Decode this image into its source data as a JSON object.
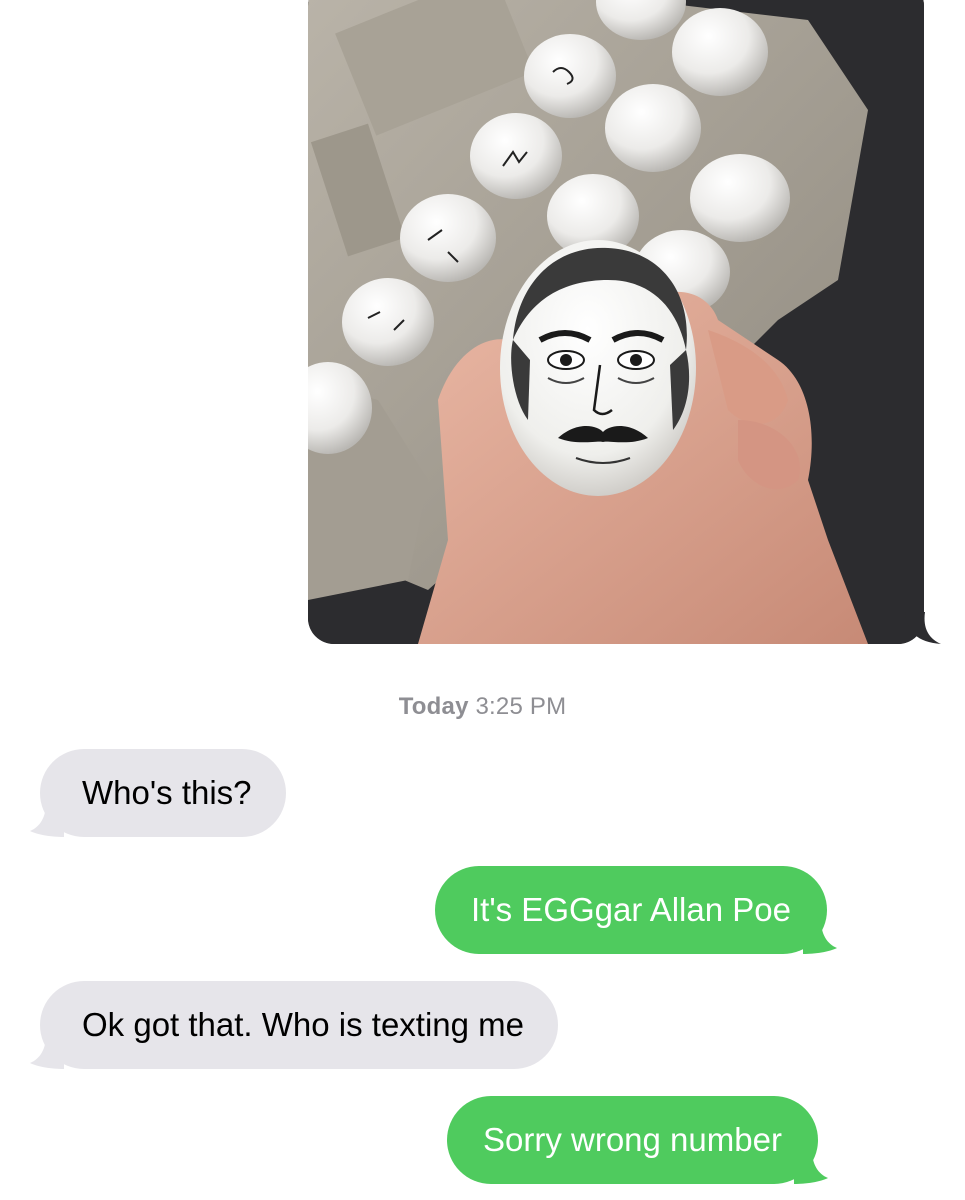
{
  "thread": {
    "photo": {
      "description_icon": "photo-of-eggs-icon"
    },
    "timestamp": {
      "day": "Today",
      "time": "3:25 PM"
    },
    "messages": [
      {
        "direction": "received",
        "text": "Who's this?"
      },
      {
        "direction": "sent",
        "text": "It's EGGgar Allan Poe"
      },
      {
        "direction": "received",
        "text": "Ok got that. Who is texting me"
      },
      {
        "direction": "sent",
        "text": "Sorry wrong number"
      }
    ]
  },
  "colors": {
    "sent_bubble": "#4fcb5e",
    "received_bubble": "#e6e5ea",
    "timestamp_text": "#8e8e93"
  }
}
